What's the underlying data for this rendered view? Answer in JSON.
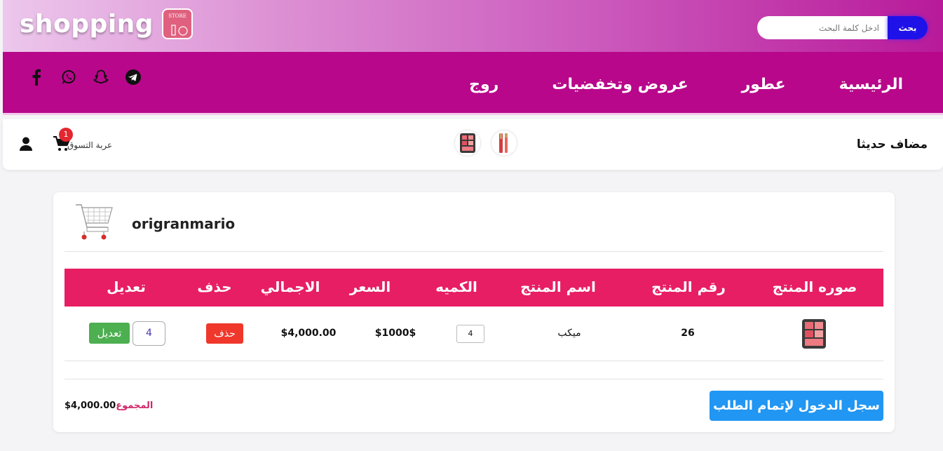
{
  "header": {
    "brand": "shopping",
    "logo_text": "STORE",
    "search_placeholder": "ادخل كلمة البحث",
    "search_button": "بحث"
  },
  "nav": {
    "items": [
      "الرئيسية",
      "عطور",
      "عروض وتخفضيات",
      "روج"
    ],
    "social_icons": [
      "facebook-icon",
      "whatsapp-icon",
      "snapchat-icon",
      "telegram-icon"
    ]
  },
  "recent": {
    "title": "مضاف حديثا",
    "thumbs": [
      "palette-thumb",
      "lipstick-thumb"
    ],
    "cart_label": "عربة التسوق",
    "cart_count": "1"
  },
  "cart": {
    "username": "origranmario",
    "columns": [
      "صوره المنتج",
      "رقم المنتج",
      "اسم المنتج",
      "الكميه",
      "السعر",
      "الاجمالي",
      "حذف",
      "تعديل"
    ],
    "rows": [
      {
        "product_id": "26",
        "name": "ميكب",
        "quantity": "4",
        "price": "$1000$",
        "total": "$4,000.00",
        "delete_label": "حذف",
        "edit_value": "4",
        "edit_label": "تعديل"
      }
    ],
    "sum_label": "المجموع",
    "sum_value": "$4,000.00",
    "checkout_label": "سجل الدخول لإتمام الطلب"
  },
  "colors": {
    "nav_bg": "#b8078a",
    "table_header": "#e71e63",
    "checkout": "#2196f3",
    "delete": "#f0372c",
    "edit": "#4caf50",
    "search_button": "#1f12e8"
  }
}
